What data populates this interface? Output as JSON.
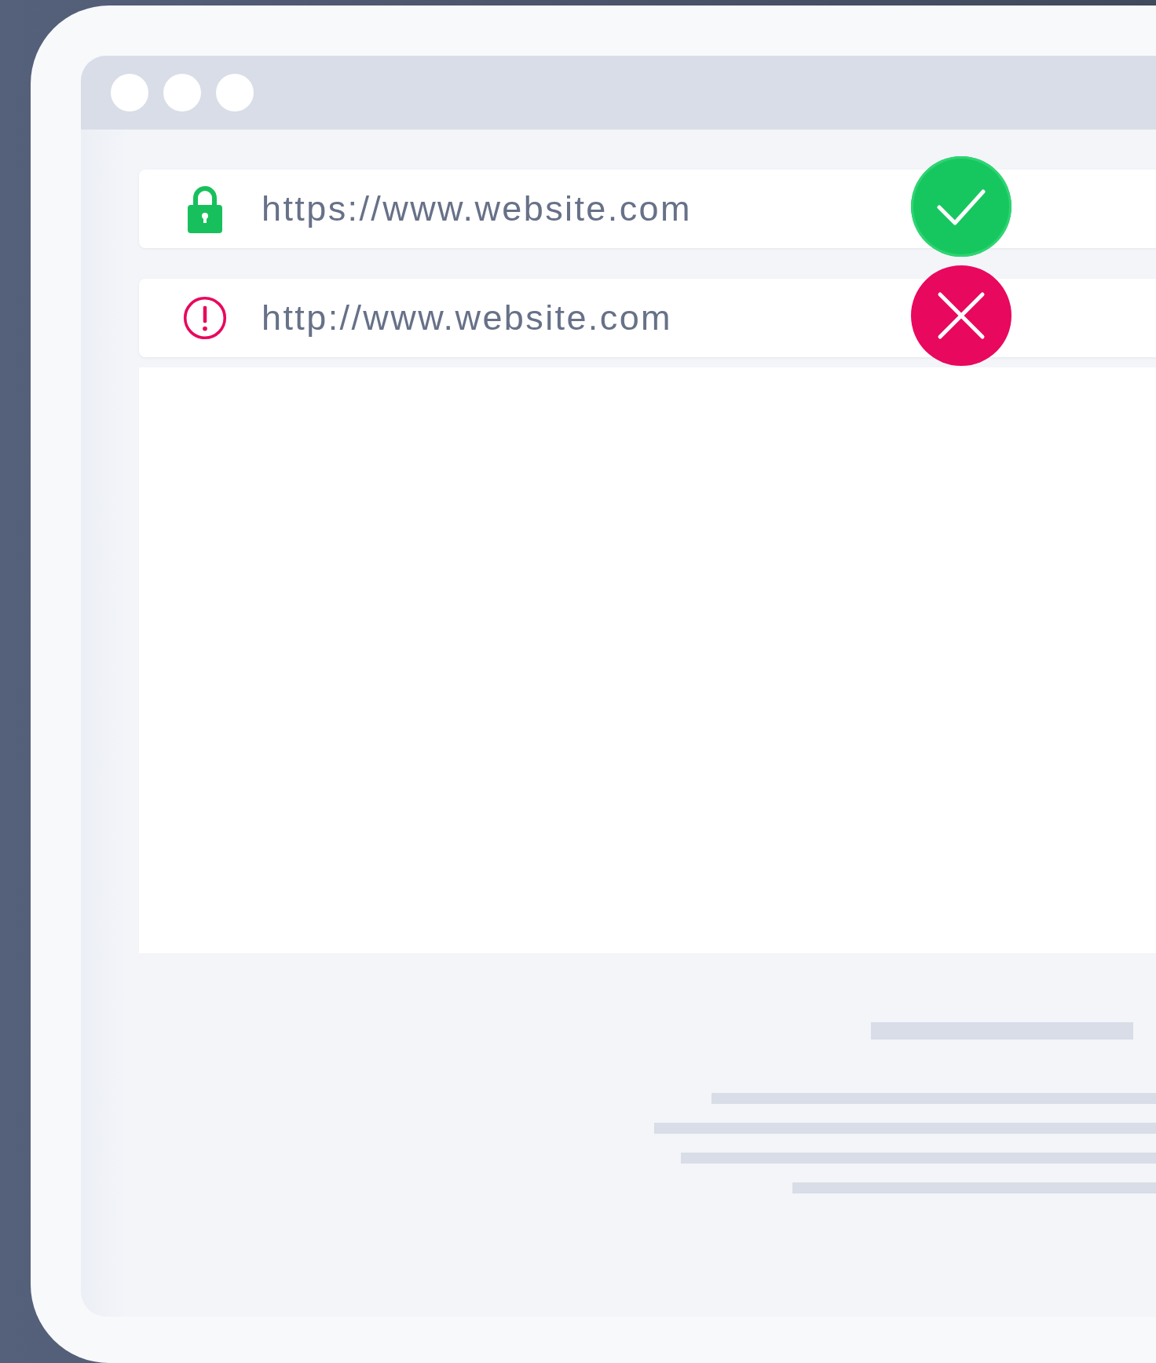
{
  "address_bars": [
    {
      "url": "https://www.website.com",
      "secure": true
    },
    {
      "url": "http://www.website.com",
      "secure": false
    }
  ]
}
